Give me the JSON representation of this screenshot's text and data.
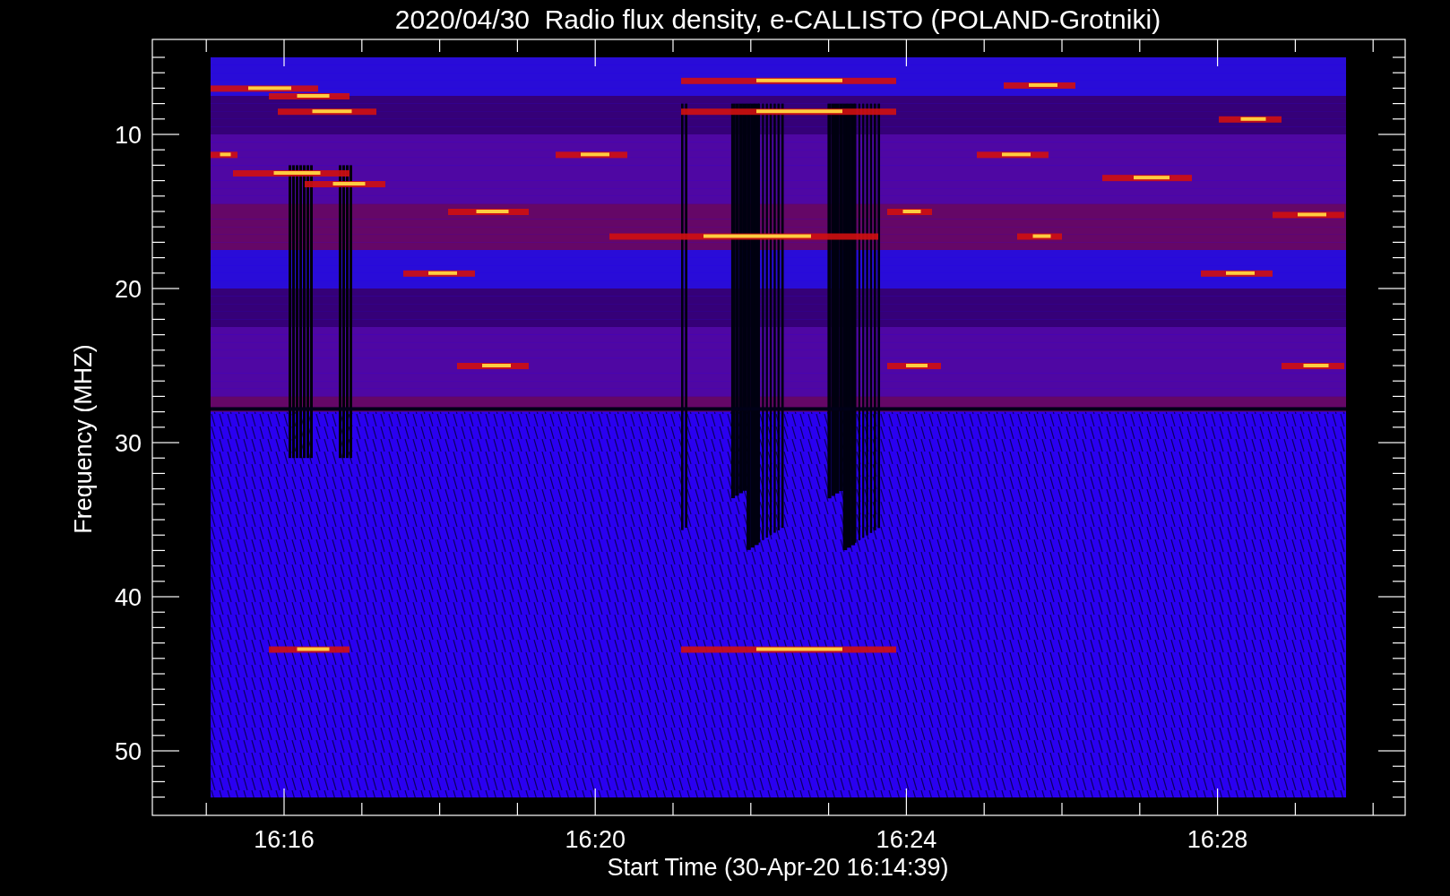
{
  "title": "2020/04/30  Radio flux density, e-CALLISTO (POLAND-Grotniki)",
  "y_axis": {
    "label": "Frequency (MHZ)",
    "ticks": [
      "10",
      "20",
      "30",
      "40",
      "50"
    ]
  },
  "x_axis": {
    "label": "Start Time (30-Apr-20 16:14:39)",
    "ticks": [
      "16:16",
      "16:20",
      "16:24",
      "16:28"
    ]
  }
}
